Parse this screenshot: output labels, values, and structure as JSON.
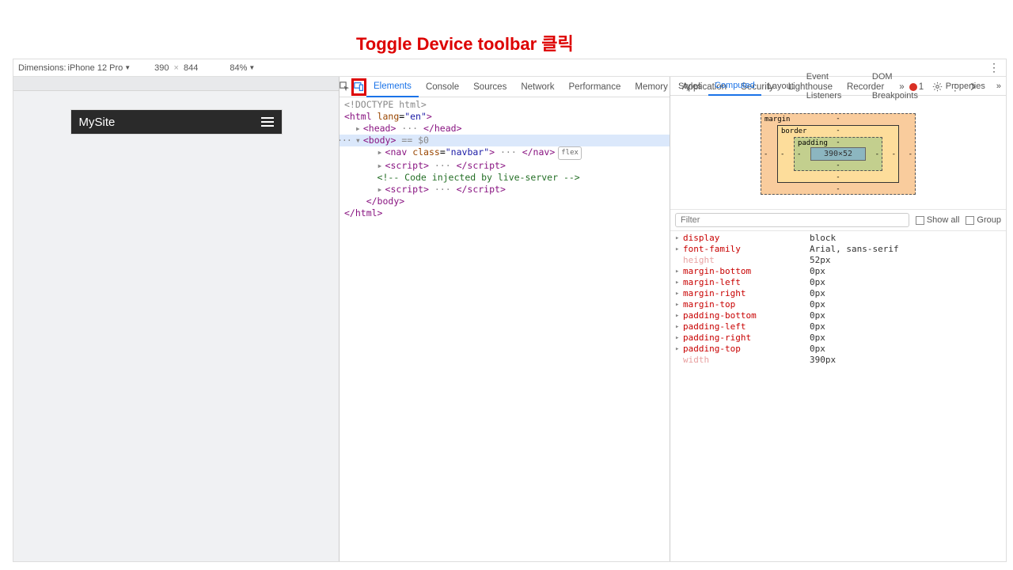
{
  "annotation": "Toggle Device toolbar 클릭",
  "device_bar": {
    "label": "Dimensions:",
    "device": "iPhone 12 Pro",
    "width": "390",
    "x": "×",
    "height": "844",
    "zoom": "84%"
  },
  "preview": {
    "site_title": "MySite"
  },
  "devtools_tabs": [
    "Elements",
    "Console",
    "Sources",
    "Network",
    "Performance",
    "Memory",
    "Application",
    "Security",
    "Lighthouse",
    "Recorder"
  ],
  "devtools_tabs_more": "»",
  "error_count": "1",
  "dom": {
    "doctype": "<!DOCTYPE html>",
    "html_open": "<html lang=\"en\">",
    "head": "<head> ··· </head>",
    "body_open": "<body>",
    "body_sel": " == $0",
    "nav": "<nav class=\"navbar\"> ··· </nav>",
    "nav_badge": "flex",
    "script1": "<script> ··· </script>",
    "comment": "<!-- Code injected by live-server -->",
    "script2": "<script> ··· </script>",
    "body_close": "</body>",
    "html_close": "</html>"
  },
  "side_tabs": [
    "Styles",
    "Computed",
    "Layout",
    "Event Listeners",
    "DOM Breakpoints",
    "Properties"
  ],
  "side_tabs_more": "»",
  "box_model": {
    "margin_label": "margin",
    "border_label": "border",
    "padding_label": "padding",
    "content": "390×52",
    "dash": "-"
  },
  "filter": {
    "placeholder": "Filter",
    "show_all": "Show all",
    "group": "Group"
  },
  "computed": [
    {
      "arrow": "▸",
      "name": "display",
      "val": "block",
      "inactive": false
    },
    {
      "arrow": "▸",
      "name": "font-family",
      "val": "Arial, sans-serif",
      "inactive": false
    },
    {
      "arrow": "",
      "name": "height",
      "val": "52px",
      "inactive": true
    },
    {
      "arrow": "▸",
      "name": "margin-bottom",
      "val": "0px",
      "inactive": false
    },
    {
      "arrow": "▸",
      "name": "margin-left",
      "val": "0px",
      "inactive": false
    },
    {
      "arrow": "▸",
      "name": "margin-right",
      "val": "0px",
      "inactive": false
    },
    {
      "arrow": "▸",
      "name": "margin-top",
      "val": "0px",
      "inactive": false
    },
    {
      "arrow": "▸",
      "name": "padding-bottom",
      "val": "0px",
      "inactive": false
    },
    {
      "arrow": "▸",
      "name": "padding-left",
      "val": "0px",
      "inactive": false
    },
    {
      "arrow": "▸",
      "name": "padding-right",
      "val": "0px",
      "inactive": false
    },
    {
      "arrow": "▸",
      "name": "padding-top",
      "val": "0px",
      "inactive": false
    },
    {
      "arrow": "",
      "name": "width",
      "val": "390px",
      "inactive": true
    }
  ]
}
